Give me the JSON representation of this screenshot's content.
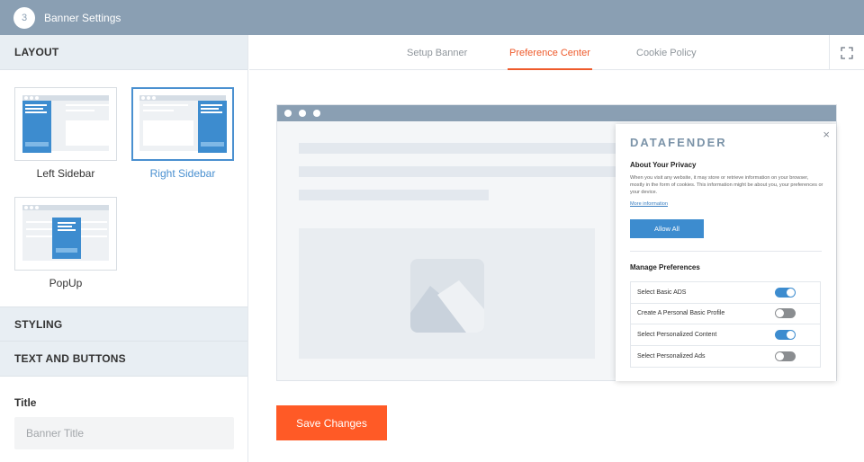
{
  "header": {
    "step": "3",
    "title": "Banner Settings"
  },
  "sidebar": {
    "layout_heading": "LAYOUT",
    "layouts": [
      {
        "label": "Left Sidebar",
        "selected": false
      },
      {
        "label": "Right Sidebar",
        "selected": true
      },
      {
        "label": "PopUp",
        "selected": false
      }
    ],
    "styling_heading": "STYLING",
    "text_buttons_heading": "TEXT AND BUTTONS",
    "title_field": {
      "label": "Title",
      "value": "",
      "placeholder": "Banner Title"
    }
  },
  "tabs": [
    {
      "label": "Setup Banner",
      "active": false
    },
    {
      "label": "Preference Center",
      "active": true
    },
    {
      "label": "Cookie Policy",
      "active": false
    }
  ],
  "preview": {
    "popup": {
      "brand": "DATAFENDER",
      "close": "×",
      "about_title": "About Your Privacy",
      "about_text": "When you visit any website, it may store or retrieve information on your browser, mostly in the form of cookies. This information might be about you, your preferences or your device.",
      "more_link": "More information",
      "allow_all": "Allow All",
      "manage_title": "Manage Preferences",
      "preferences": [
        {
          "label": "Select Basic ADS",
          "enabled": true
        },
        {
          "label": "Create A Personal Basic Profile",
          "enabled": false
        },
        {
          "label": "Select Personalized Content",
          "enabled": true
        },
        {
          "label": "Select Personalized Ads",
          "enabled": false
        }
      ]
    }
  },
  "actions": {
    "save_label": "Save Changes"
  },
  "colors": {
    "accent": "#ee5a2b",
    "primary_blue": "#3d8ccf",
    "header_bg": "#8a9fb3"
  },
  "icons": {
    "expand": "expand-icon",
    "close": "close-icon",
    "image_placeholder": "image-icon"
  }
}
